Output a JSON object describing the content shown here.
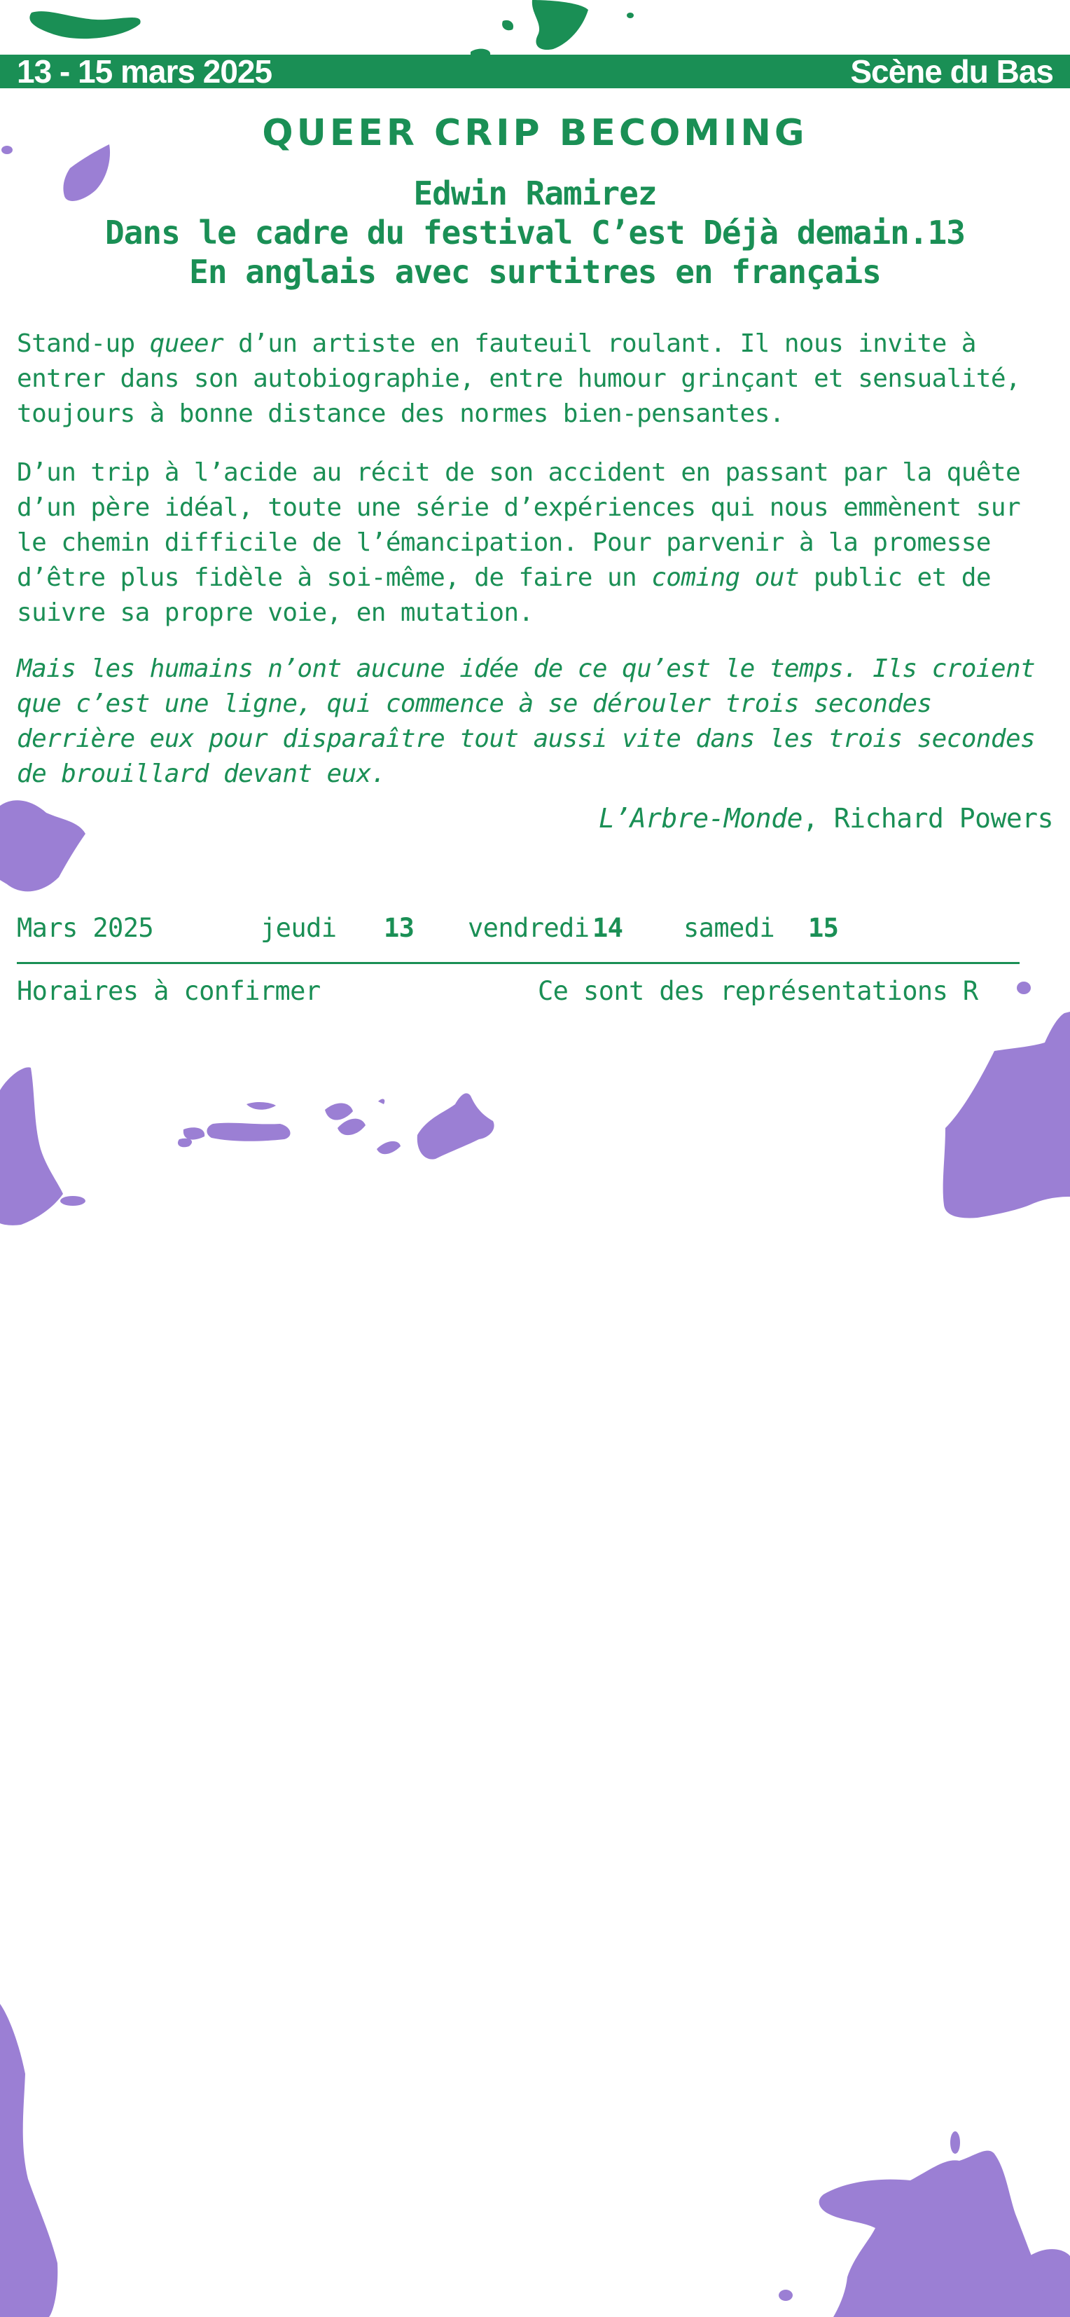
{
  "banner": {
    "dates": "13 - 15 mars 2025",
    "venue": "Scène du Bas"
  },
  "show": {
    "title": "QUEER CRIP BECOMING",
    "artist": "Edwin Ramirez",
    "festival_line": "Dans le cadre du festival C’est Déjà demain.13",
    "language_line": "En anglais avec surtitres en français"
  },
  "description": {
    "p1_before": "Stand-up ",
    "p1_em": "queer",
    "p1_after": " d’un artiste en fauteuil roulant. Il nous invite à entrer dans son autobiographie, entre humour grinçant et sensualité, toujours à bonne distance des normes bien-pensantes.",
    "p2_before": "D’un trip à l’acide au récit de son accident en passant par la quête d’un père idéal, toute une série d’expériences qui nous emmènent sur le chemin difficile de l’émancipation. Pour parvenir à la promesse d’être plus fidèle à soi-même, de faire un ",
    "p2_em": "coming out",
    "p2_after": " public et de suivre sa propre voie, en mutation."
  },
  "quote": {
    "text": "Mais les humains n’ont aucune idée de ce qu’est le temps. Ils croient que c’est une ligne, qui commence à se dérouler trois secondes derrière eux pour disparaître tout aussi vite dans les trois secondes de brouillard devant eux.",
    "work": "L’Arbre-Monde",
    "author": ", Richard Powers"
  },
  "schedule": {
    "month": "Mars 2025",
    "days": [
      {
        "day": "jeudi",
        "num": "13"
      },
      {
        "day": "vendredi",
        "num": "14"
      },
      {
        "day": "samedi",
        "num": "15"
      }
    ],
    "hours_note": "Horaires à confirmer",
    "representations_note": "Ce sont des représentations R"
  },
  "colors": {
    "accent": "#1a8f55",
    "blob": "#9b7fd4"
  }
}
